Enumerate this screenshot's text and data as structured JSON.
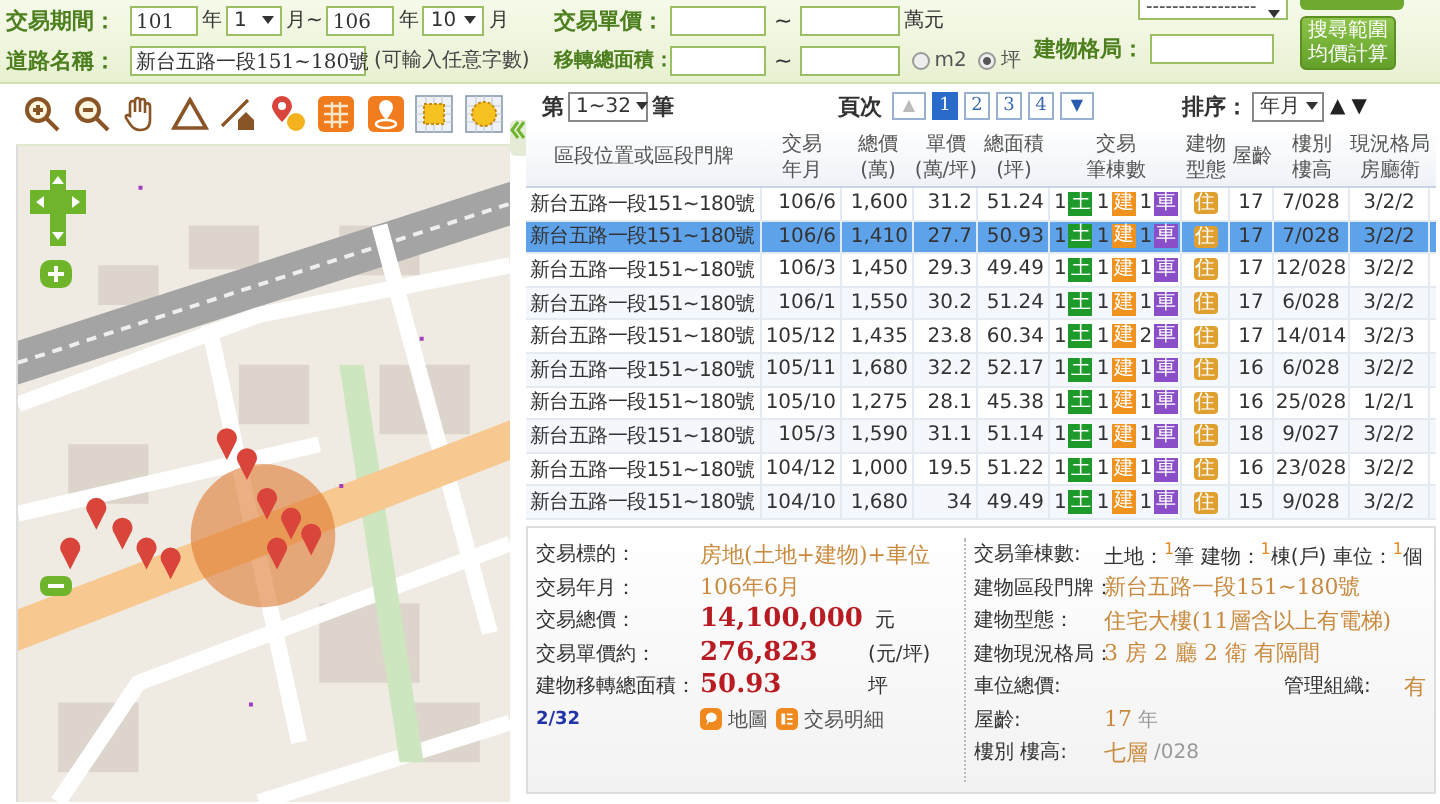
{
  "search_form": {
    "period": {
      "label": "交易期間：",
      "start_year": "101",
      "start_year_unit": "年",
      "start_month": "1",
      "start_month_unit": "月~",
      "end_year": "106",
      "end_year_unit": "年",
      "end_month": "10",
      "end_month_unit": "月"
    },
    "unit_price": {
      "label": "交易單價：",
      "separator": "~",
      "unit": "萬元"
    },
    "road": {
      "label": "道路名稱：",
      "value": "新台五路一段151~180號",
      "hint": "(可輸入任意字數)"
    },
    "area": {
      "label": "移轉總面積：",
      "separator": "~",
      "units": [
        {
          "label": "m2",
          "selected": false
        },
        {
          "label": "坪",
          "selected": true
        }
      ]
    },
    "type_select": {
      "value": "-----------------"
    },
    "layout": {
      "label": "建物格局："
    },
    "search_button": {
      "label": "搜尋範圍均價計算"
    }
  },
  "results": {
    "range_prefix": "第",
    "range": "1~32",
    "range_suffix": "筆",
    "pager_label": "頁次",
    "prev": {
      "label": "▲",
      "disabled": true
    },
    "pages": [
      {
        "label": "1",
        "selected": true
      },
      {
        "label": "2",
        "selected": false
      },
      {
        "label": "3",
        "selected": false
      },
      {
        "label": "4",
        "selected": false
      }
    ],
    "next": {
      "label": "▼",
      "disabled": false
    },
    "sort_label": "排序：",
    "sort_value": "年月",
    "sort_asc": "▲",
    "sort_desc": "▼"
  },
  "table": {
    "columns": [
      [
        "區段位置或區段門牌"
      ],
      [
        "交易",
        "年月"
      ],
      [
        "總價",
        "(萬)"
      ],
      [
        "單價",
        "(萬/坪)"
      ],
      [
        "總面積",
        "(坪)"
      ],
      [
        "交易",
        "筆棟數"
      ],
      [
        "建物",
        "型態"
      ],
      [
        "屋齡"
      ],
      [
        "樓別",
        "樓高"
      ],
      [
        "現況格局",
        "房廳衛"
      ]
    ],
    "rows": [
      {
        "address": "新台五路一段151~180號",
        "date": "106/6",
        "total": "1,600",
        "unit_price": "31.2",
        "area": "51.24",
        "units": [
          {
            "count": "1",
            "tag": "土",
            "kind": "land"
          },
          {
            "count": "1",
            "tag": "建",
            "kind": "building"
          },
          {
            "count": "1",
            "tag": "車",
            "kind": "parking"
          }
        ],
        "type": "住",
        "age": "17",
        "floor": "7/028",
        "layout": "3/2/2",
        "selected": false
      },
      {
        "address": "新台五路一段151~180號",
        "date": "106/6",
        "total": "1,410",
        "unit_price": "27.7",
        "area": "50.93",
        "units": [
          {
            "count": "1",
            "tag": "土",
            "kind": "land"
          },
          {
            "count": "1",
            "tag": "建",
            "kind": "building"
          },
          {
            "count": "1",
            "tag": "車",
            "kind": "parking"
          }
        ],
        "type": "住",
        "age": "17",
        "floor": "7/028",
        "layout": "3/2/2",
        "selected": true
      },
      {
        "address": "新台五路一段151~180號",
        "date": "106/3",
        "total": "1,450",
        "unit_price": "29.3",
        "area": "49.49",
        "units": [
          {
            "count": "1",
            "tag": "土",
            "kind": "land"
          },
          {
            "count": "1",
            "tag": "建",
            "kind": "building"
          },
          {
            "count": "1",
            "tag": "車",
            "kind": "parking"
          }
        ],
        "type": "住",
        "age": "17",
        "floor": "12/028",
        "layout": "3/2/2",
        "selected": false
      },
      {
        "address": "新台五路一段151~180號",
        "date": "106/1",
        "total": "1,550",
        "unit_price": "30.2",
        "area": "51.24",
        "units": [
          {
            "count": "1",
            "tag": "土",
            "kind": "land"
          },
          {
            "count": "1",
            "tag": "建",
            "kind": "building"
          },
          {
            "count": "1",
            "tag": "車",
            "kind": "parking"
          }
        ],
        "type": "住",
        "age": "17",
        "floor": "6/028",
        "layout": "3/2/2",
        "selected": false
      },
      {
        "address": "新台五路一段151~180號",
        "date": "105/12",
        "total": "1,435",
        "unit_price": "23.8",
        "area": "60.34",
        "units": [
          {
            "count": "1",
            "tag": "土",
            "kind": "land"
          },
          {
            "count": "1",
            "tag": "建",
            "kind": "building"
          },
          {
            "count": "2",
            "tag": "車",
            "kind": "parking"
          }
        ],
        "type": "住",
        "age": "17",
        "floor": "14/014",
        "layout": "3/2/3",
        "selected": false
      },
      {
        "address": "新台五路一段151~180號",
        "date": "105/11",
        "total": "1,680",
        "unit_price": "32.2",
        "area": "52.17",
        "units": [
          {
            "count": "1",
            "tag": "土",
            "kind": "land"
          },
          {
            "count": "1",
            "tag": "建",
            "kind": "building"
          },
          {
            "count": "1",
            "tag": "車",
            "kind": "parking"
          }
        ],
        "type": "住",
        "age": "16",
        "floor": "6/028",
        "layout": "3/2/2",
        "selected": false
      },
      {
        "address": "新台五路一段151~180號",
        "date": "105/10",
        "total": "1,275",
        "unit_price": "28.1",
        "area": "45.38",
        "units": [
          {
            "count": "1",
            "tag": "土",
            "kind": "land"
          },
          {
            "count": "1",
            "tag": "建",
            "kind": "building"
          },
          {
            "count": "1",
            "tag": "車",
            "kind": "parking"
          }
        ],
        "type": "住",
        "age": "16",
        "floor": "25/028",
        "layout": "1/2/1",
        "selected": false
      },
      {
        "address": "新台五路一段151~180號",
        "date": "105/3",
        "total": "1,590",
        "unit_price": "31.1",
        "area": "51.14",
        "units": [
          {
            "count": "1",
            "tag": "土",
            "kind": "land"
          },
          {
            "count": "1",
            "tag": "建",
            "kind": "building"
          },
          {
            "count": "1",
            "tag": "車",
            "kind": "parking"
          }
        ],
        "type": "住",
        "age": "18",
        "floor": "9/027",
        "layout": "3/2/2",
        "selected": false
      },
      {
        "address": "新台五路一段151~180號",
        "date": "104/12",
        "total": "1,000",
        "unit_price": "19.5",
        "area": "51.22",
        "units": [
          {
            "count": "1",
            "tag": "土",
            "kind": "land"
          },
          {
            "count": "1",
            "tag": "建",
            "kind": "building"
          },
          {
            "count": "1",
            "tag": "車",
            "kind": "parking"
          }
        ],
        "type": "住",
        "age": "16",
        "floor": "23/028",
        "layout": "3/2/2",
        "selected": false
      },
      {
        "address": "新台五路一段151~180號",
        "date": "104/10",
        "total": "1,680",
        "unit_price": "34",
        "area": "49.49",
        "units": [
          {
            "count": "1",
            "tag": "土",
            "kind": "land"
          },
          {
            "count": "1",
            "tag": "建",
            "kind": "building"
          },
          {
            "count": "1",
            "tag": "車",
            "kind": "parking"
          }
        ],
        "type": "住",
        "age": "15",
        "floor": "9/028",
        "layout": "3/2/2",
        "selected": false
      }
    ]
  },
  "detail": {
    "left": [
      {
        "label": "交易標的：",
        "value": "房地(土地+建物)+車位",
        "kind": "plain"
      },
      {
        "label": "交易年月：",
        "value": "106年6月",
        "kind": "plain"
      },
      {
        "label": "交易總價：",
        "value": "14,100,000",
        "unit": "元",
        "kind": "big"
      },
      {
        "label": "交易單價約：",
        "value": "276,823",
        "unit": "(元/坪)",
        "kind": "big"
      },
      {
        "label": "建物移轉總面積：",
        "value": "50.93",
        "unit": "坪",
        "kind": "big"
      }
    ],
    "position": "2/32",
    "actions": [
      {
        "label": "地圖",
        "kind": "map"
      },
      {
        "label": "交易明細",
        "kind": "list"
      }
    ],
    "right": [
      {
        "label": "交易筆棟數:",
        "value": "土地：$^{1}$筆 建物：$^{1}$棟(戶) 車位：$^{1}$個",
        "kind": "counts"
      },
      {
        "label": "建物區段門牌：",
        "value": "新台五路一段151~180號",
        "kind": "plain"
      },
      {
        "label": "建物型態：",
        "value": "住宅大樓(11層含以上有電梯)",
        "kind": "plain"
      },
      {
        "label": "建物現況格局：",
        "value": "3 房 2 廳 2 衛 有隔間",
        "kind": "plain"
      },
      {
        "label": "車位總價:",
        "label2": "管理組織:",
        "value2": "有",
        "kind": "pair"
      },
      {
        "label": "屋齡:",
        "value": "17",
        "unit": "年",
        "kind": "plain"
      },
      {
        "label": "樓別 樓高:",
        "value": "七層",
        "unit": "/028",
        "kind": "plain"
      }
    ]
  }
}
